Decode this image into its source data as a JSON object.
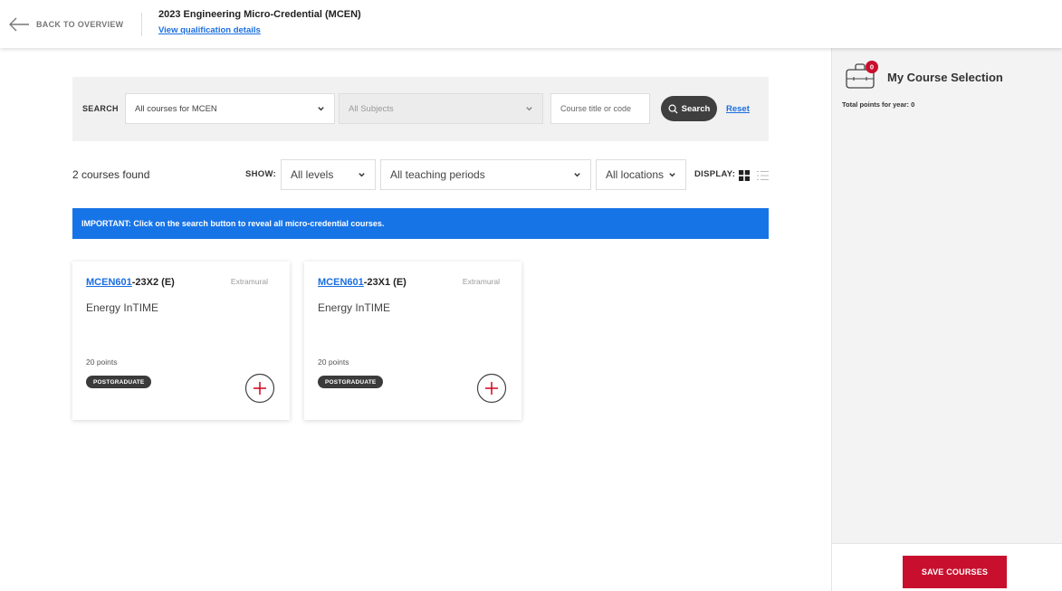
{
  "header": {
    "back_label": "BACK TO OVERVIEW",
    "title": "2023 Engineering Micro-Credential (MCEN)",
    "details_link": "View qualification details"
  },
  "search": {
    "label": "SEARCH",
    "course_filter": "All courses for MCEN",
    "subject_filter": "All Subjects",
    "input_placeholder": "Course title or code",
    "input_value": "",
    "button_label": "Search",
    "reset_label": "Reset"
  },
  "results": {
    "count_text": "2 courses found",
    "show_label": "SHOW:",
    "level_filter": "All levels",
    "period_filter": "All teaching periods",
    "location_filter": "All locations",
    "display_label": "DISPLAY:",
    "notice_bold": "IMPORTANT:",
    "notice_text": " Click on the search button to reveal all micro-credential courses."
  },
  "courses": [
    {
      "code": "MCEN601",
      "suffix": "-23X2 (E)",
      "mode": "Extramural",
      "name": "Energy InTIME",
      "points": "20 points",
      "badge": "POSTGRADUATE"
    },
    {
      "code": "MCEN601",
      "suffix": "-23X1 (E)",
      "mode": "Extramural",
      "name": "Energy InTIME",
      "points": "20 points",
      "badge": "POSTGRADUATE"
    }
  ],
  "sidebar": {
    "cart_count": "0",
    "title": "My Course Selection",
    "total_points": "Total points for year: 0",
    "save_label": "SAVE COURSES"
  },
  "colors": {
    "brand_red": "#c8102e",
    "link_blue": "#1a6ee0",
    "notice_blue": "#1774e6"
  },
  "icons": {
    "back": "arrow-left-icon",
    "search": "magnifier-icon",
    "add": "plus-circle-icon",
    "cart": "briefcase-icon",
    "grid": "grid-view-icon",
    "list": "list-view-icon"
  }
}
